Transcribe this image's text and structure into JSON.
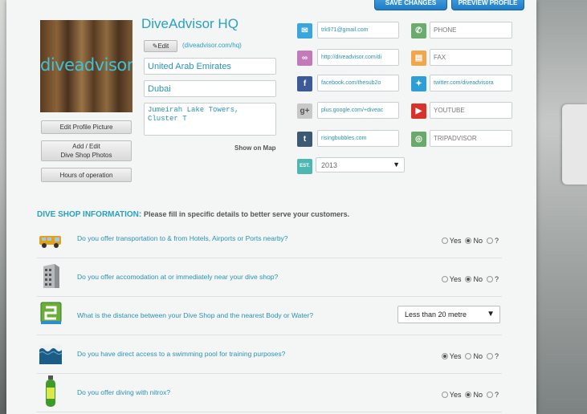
{
  "header": {
    "save_label": "SAVE CHANGES",
    "preview_label": "PREVIEW PROFILE"
  },
  "profile": {
    "logo_text": "diveadvisor",
    "name": "DiveAdvisor HQ",
    "edit_label": "Edit",
    "url": "(diveadvisor.com/hq)",
    "country": "United Arab Emirates",
    "city": "Dubai",
    "address_line1": "Jumeirah Lake Towers,",
    "address_line2": "Cluster T",
    "show_map": "Show on Map",
    "edit_picture": "Edit Profile Picture",
    "add_photos_line1": "Add / Edit",
    "add_photos_line2": "Dive Shop Photos",
    "hours": "Hours of operation"
  },
  "contacts": {
    "email": "trk971@gmail.com",
    "phone": "PHONE",
    "website": "http://diveadvisor.com/di",
    "fax": "FAX",
    "facebook": "facebook.com/thesub2o",
    "twitter": "twitter.com/diveadvisora",
    "googleplus": "plus.google.com/+diveac",
    "youtube": "YOUTUBE",
    "tumblr": "risingbubbles.com",
    "tripadvisor": "TRIPADVISOR",
    "est_label": "EST.",
    "established": "2013"
  },
  "colors": {
    "email": "#3aa6dd",
    "phone": "#6aab6e",
    "website": "#c47ab8",
    "fax": "#f0a64a",
    "facebook": "#3b5b98",
    "twitter": "#2d9fd6",
    "googleplus": "#c8c8c8",
    "youtube": "#d8322a",
    "tumblr": "#3c5a74",
    "tripadvisor": "#6aa96c",
    "est": "#4fb7b2"
  },
  "section": {
    "title": "DIVE SHOP INFORMATION:",
    "subtitle": "Please fill in specific details to better serve your customers."
  },
  "questions": [
    {
      "icon": "van-icon",
      "text": "Do you offer transportation to & from Hotels, Airports or Ports nearby?",
      "answer": "No"
    },
    {
      "icon": "building-icon",
      "text": "Do you offer accomodation at or immediately near your dive shop?",
      "answer": "No"
    },
    {
      "icon": "distance-icon",
      "text": "What is the distance between your Dive Shop and the nearest Body or Water?",
      "select": "Less than 20 metre"
    },
    {
      "icon": "pool-icon",
      "text": "Do you have direct access to a swimming pool for training purposes?",
      "answer": "Yes"
    },
    {
      "icon": "nitrox-tank-icon",
      "text": "Do you offer diving with nitrox?",
      "answer": "No"
    }
  ],
  "radio_labels": {
    "yes": "Yes",
    "no": "No",
    "unknown": "?"
  }
}
